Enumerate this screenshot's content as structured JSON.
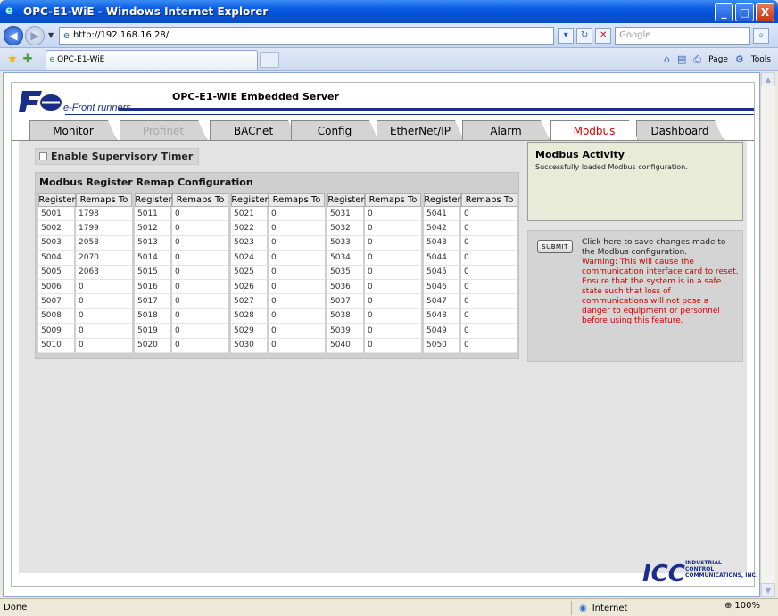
{
  "window": {
    "title": "OPC-E1-WiE - Windows Internet Explorer",
    "controls": [
      "_",
      "□",
      "X"
    ]
  },
  "addressbar": {
    "url": "http://192.168.16.28/",
    "search_placeholder": "Google"
  },
  "browser": {
    "tab_label": "OPC-E1-WiE",
    "page_menu": "Page",
    "tools_menu": "Tools"
  },
  "header": {
    "tagline": "e-Front runners",
    "server_title": "OPC-E1-WiE Embedded Server"
  },
  "tabs": [
    {
      "label": "Monitor",
      "state": "normal"
    },
    {
      "label": "Profinet",
      "state": "disabled"
    },
    {
      "label": "BACnet",
      "state": "normal"
    },
    {
      "label": "Config",
      "state": "normal"
    },
    {
      "label": "EtherNet/IP",
      "state": "normal"
    },
    {
      "label": "Alarm",
      "state": "normal"
    },
    {
      "label": "Modbus",
      "state": "active"
    },
    {
      "label": "Dashboard",
      "state": "normal"
    }
  ],
  "modbus": {
    "supervisory_label": "Enable Supervisory Timer",
    "remap_title": "Modbus Register Remap Configuration",
    "col_register": "Register",
    "col_remaps": "Remaps To",
    "groups": [
      {
        "rows": [
          [
            "5001",
            "1798"
          ],
          [
            "5002",
            "1799"
          ],
          [
            "5003",
            "2058"
          ],
          [
            "5004",
            "2070"
          ],
          [
            "5005",
            "2063"
          ],
          [
            "5006",
            "0"
          ],
          [
            "5007",
            "0"
          ],
          [
            "5008",
            "0"
          ],
          [
            "5009",
            "0"
          ],
          [
            "5010",
            "0"
          ]
        ]
      },
      {
        "rows": [
          [
            "5011",
            "0"
          ],
          [
            "5012",
            "0"
          ],
          [
            "5013",
            "0"
          ],
          [
            "5014",
            "0"
          ],
          [
            "5015",
            "0"
          ],
          [
            "5016",
            "0"
          ],
          [
            "5017",
            "0"
          ],
          [
            "5018",
            "0"
          ],
          [
            "5019",
            "0"
          ],
          [
            "5020",
            "0"
          ]
        ]
      },
      {
        "rows": [
          [
            "5021",
            "0"
          ],
          [
            "5022",
            "0"
          ],
          [
            "5023",
            "0"
          ],
          [
            "5024",
            "0"
          ],
          [
            "5025",
            "0"
          ],
          [
            "5026",
            "0"
          ],
          [
            "5027",
            "0"
          ],
          [
            "5028",
            "0"
          ],
          [
            "5029",
            "0"
          ],
          [
            "5030",
            "0"
          ]
        ]
      },
      {
        "rows": [
          [
            "5031",
            "0"
          ],
          [
            "5032",
            "0"
          ],
          [
            "5033",
            "0"
          ],
          [
            "5034",
            "0"
          ],
          [
            "5035",
            "0"
          ],
          [
            "5036",
            "0"
          ],
          [
            "5037",
            "0"
          ],
          [
            "5038",
            "0"
          ],
          [
            "5039",
            "0"
          ],
          [
            "5040",
            "0"
          ]
        ]
      },
      {
        "rows": [
          [
            "5041",
            "0"
          ],
          [
            "5042",
            "0"
          ],
          [
            "5043",
            "0"
          ],
          [
            "5044",
            "0"
          ],
          [
            "5045",
            "0"
          ],
          [
            "5046",
            "0"
          ],
          [
            "5047",
            "0"
          ],
          [
            "5048",
            "0"
          ],
          [
            "5049",
            "0"
          ],
          [
            "5050",
            "0"
          ]
        ]
      }
    ],
    "activity_title": "Modbus Activity",
    "activity_message": "Successfully loaded Modbus configuration.",
    "submit_label": "SUBMIT",
    "submit_text": "Click here to save changes made to the Modbus configuration.",
    "submit_warning": "Warning: This will cause the communication interface card to reset. Ensure that the system is in a safe state such that loss of communications will not pose a danger to equipment or personnel before using this feature."
  },
  "footer": {
    "logo_text": [
      "INDUSTRIAL",
      "CONTROL",
      "COMMUNICATIONS, INC."
    ]
  },
  "statusbar": {
    "status": "Done",
    "zone": "Internet",
    "zoom": "100%"
  },
  "colors": {
    "accent_red": "#d00000",
    "brand_blue": "#1a2d8a",
    "panel_gray": "#e3e3e3"
  }
}
